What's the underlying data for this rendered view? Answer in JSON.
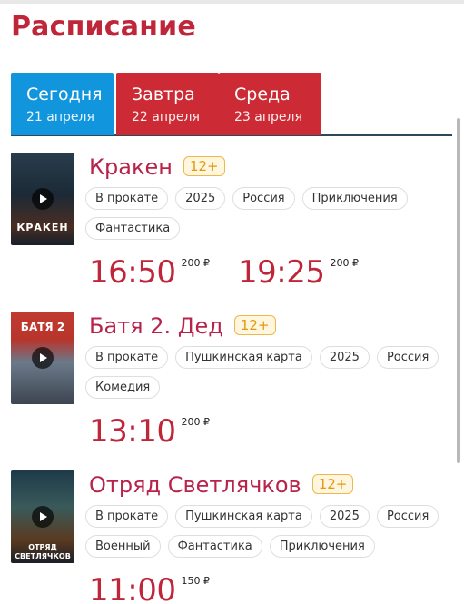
{
  "page": {
    "title": "Расписание"
  },
  "tabs": [
    {
      "name": "Сегодня",
      "date": "21 апреля",
      "active": true
    },
    {
      "name": "Завтра",
      "date": "22 апреля",
      "active": false
    },
    {
      "name": "Среда",
      "date": "23 апреля",
      "active": false
    }
  ],
  "colors": {
    "accent_red": "#c0263a",
    "tab_active": "#1196de",
    "tab_inactive": "#cc2a34",
    "age_badge": "#e39a10"
  },
  "movies": [
    {
      "title": "Кракен",
      "age": "12+",
      "poster_text": "КРАКЕН",
      "tags": [
        "В прокате",
        "2025",
        "Россия",
        "Приключения",
        "Фантастика"
      ],
      "sessions": [
        {
          "time": "16:50",
          "price": "200 ₽"
        },
        {
          "time": "19:25",
          "price": "200 ₽"
        }
      ]
    },
    {
      "title": "Батя 2. Дед",
      "age": "12+",
      "poster_text": "БАТЯ 2",
      "tags": [
        "В прокате",
        "Пушкинская карта",
        "2025",
        "Россия",
        "Комедия"
      ],
      "sessions": [
        {
          "time": "13:10",
          "price": "200 ₽"
        }
      ]
    },
    {
      "title": "Отряд Светлячков",
      "age": "12+",
      "poster_text": "ОТРЯД СВЕТЛЯЧКОВ",
      "tags": [
        "В прокате",
        "Пушкинская карта",
        "2025",
        "Россия",
        "Военный",
        "Фантастика",
        "Приключения"
      ],
      "sessions": [
        {
          "time": "11:00",
          "price": "150 ₽"
        }
      ]
    }
  ]
}
